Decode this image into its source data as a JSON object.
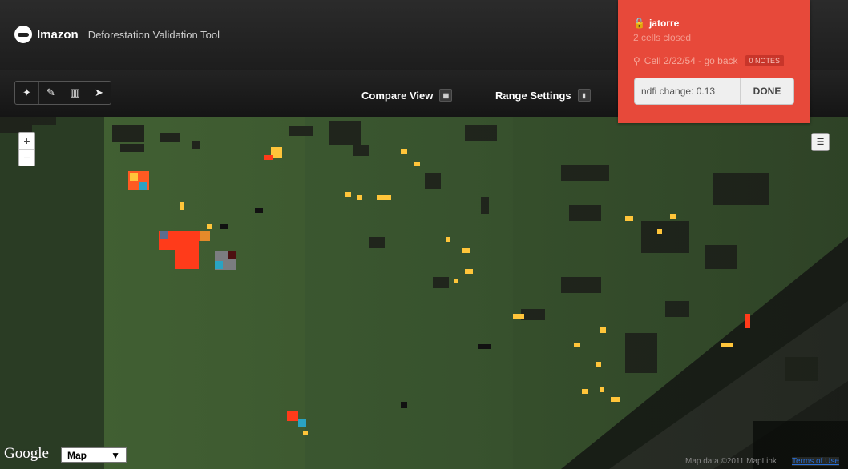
{
  "header": {
    "brand": "Imazon",
    "title": "Deforestation Validation Tool"
  },
  "toolbar": {
    "tools": [
      {
        "name": "magic-wand-icon",
        "glyph": "⚚"
      },
      {
        "name": "pencil-icon",
        "glyph": "✎"
      },
      {
        "name": "trash-icon",
        "glyph": "🗑"
      },
      {
        "name": "cursor-icon",
        "glyph": "➤"
      }
    ],
    "compare_view": "Compare View",
    "range_settings": "Range Settings"
  },
  "user_panel": {
    "username": "jatorre",
    "cells_closed": "2 cells closed",
    "cell_link": "Cell 2/22/54 - go back",
    "notes_badge": "0 NOTES",
    "ndfi_label": "ndfi change: 0.13",
    "done_label": "DONE",
    "accent_color": "#e7493a"
  },
  "map": {
    "zoom_in": "+",
    "zoom_out": "−",
    "google_logo": "Google",
    "map_type": "Map",
    "attribution": "Map data ©2011 MapLink",
    "terms": "Terms of Use"
  }
}
